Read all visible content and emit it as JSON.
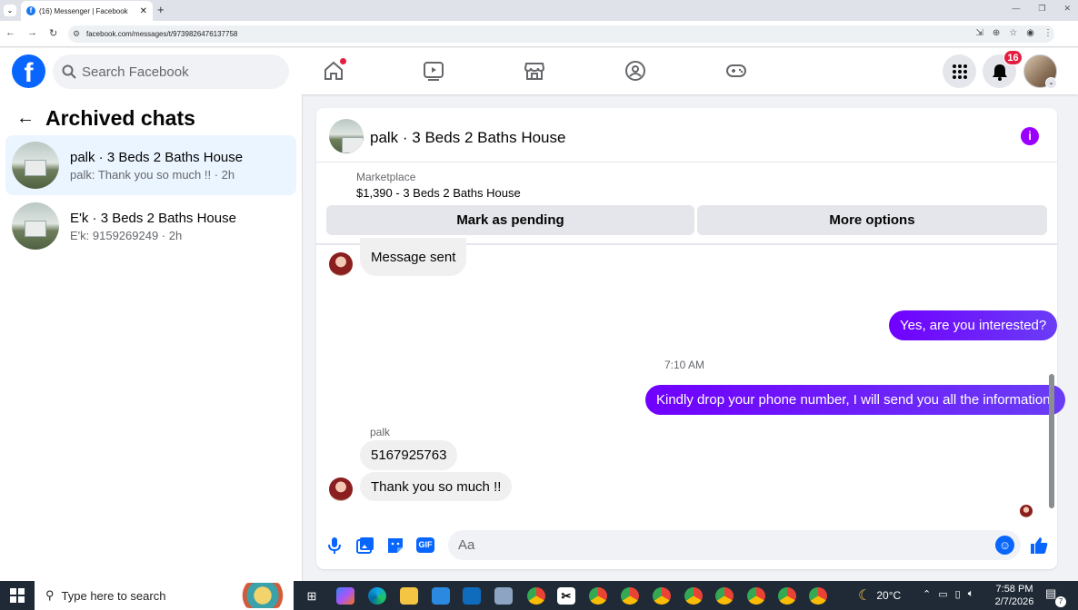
{
  "browser": {
    "tab_title": "(16) Messenger | Facebook",
    "url": "facebook.com/messages/t/9739826476137758"
  },
  "header": {
    "search_placeholder": "Search Facebook",
    "notification_count": "16"
  },
  "sidebar": {
    "title": "Archived chats",
    "chats": [
      {
        "name": "palk · 3 Beds 2 Baths House",
        "preview": "palk: Thank you so much !! · 2h",
        "active": true
      },
      {
        "name": "E'k · 3 Beds 2 Baths House",
        "preview": "E'k: 9159269249 · 2h",
        "active": false
      }
    ]
  },
  "conversation": {
    "name": "palk · 3 Beds 2 Baths House",
    "marketplace_label": "Marketplace",
    "listing": "$1,390 - 3 Beds 2 Baths House",
    "mark_pending": "Mark as pending",
    "more_options": "More options",
    "messages": {
      "m1": "Message sent",
      "m2": "Yes, are you interested?",
      "time": "7:10 AM",
      "m3": "Kindly drop your phone number, I will send you all the information.",
      "sender": "palk",
      "m4": "5167925763",
      "m5": "Thank you so much !!"
    },
    "input_placeholder": "Aa"
  },
  "taskbar": {
    "search_text": "Type here to search",
    "temperature": "20°C",
    "time": "7:58 PM",
    "date": "2/7/2026",
    "action_center_count": "7"
  },
  "colors": {
    "facebook_blue": "#0866ff",
    "messenger_purple": "#7a00ff",
    "badge_red": "#e41e3f"
  }
}
